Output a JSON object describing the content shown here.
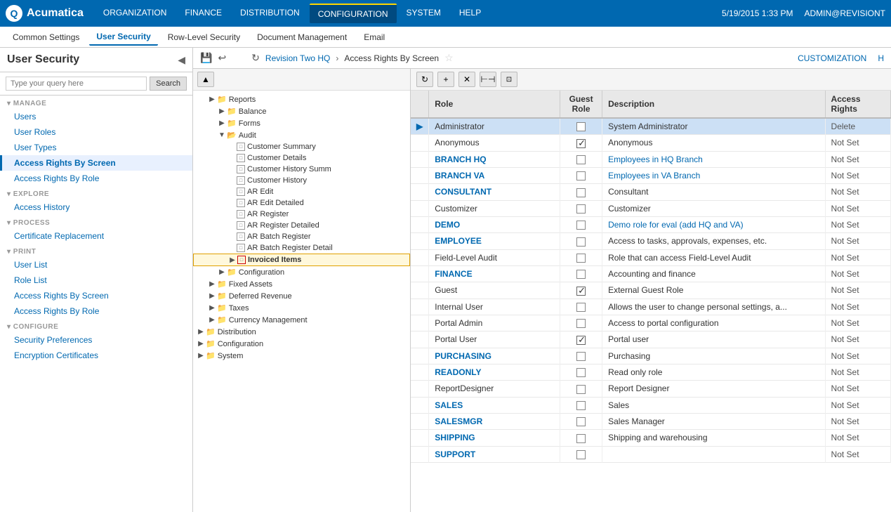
{
  "topNav": {
    "logoText": "Acumatica",
    "navItems": [
      {
        "label": "ORGANIZATION",
        "active": false
      },
      {
        "label": "FINANCE",
        "active": false
      },
      {
        "label": "DISTRIBUTION",
        "active": false
      },
      {
        "label": "CONFIGURATION",
        "active": true
      },
      {
        "label": "SYSTEM",
        "active": false
      },
      {
        "label": "HELP",
        "active": false
      }
    ],
    "datetime": "5/19/2015  1:33 PM",
    "user": "ADMIN@REVISIONT"
  },
  "subNav": {
    "items": [
      {
        "label": "Common Settings",
        "active": false
      },
      {
        "label": "User Security",
        "active": true
      },
      {
        "label": "Row-Level Security",
        "active": false
      },
      {
        "label": "Document Management",
        "active": false
      },
      {
        "label": "Email",
        "active": false
      }
    ]
  },
  "sidebar": {
    "title": "User Security",
    "searchPlaceholder": "Type your query here",
    "searchButton": "Search",
    "sections": [
      {
        "label": "MANAGE",
        "items": [
          {
            "label": "Users",
            "active": false
          },
          {
            "label": "User Roles",
            "active": false
          },
          {
            "label": "User Types",
            "active": false
          },
          {
            "label": "Access Rights By Screen",
            "active": true
          },
          {
            "label": "Access Rights By Role",
            "active": false
          }
        ]
      },
      {
        "label": "EXPLORE",
        "items": [
          {
            "label": "Access History",
            "active": false
          }
        ]
      },
      {
        "label": "PROCESS",
        "items": [
          {
            "label": "Certificate Replacement",
            "active": false
          }
        ]
      },
      {
        "label": "PRINT",
        "items": [
          {
            "label": "User List",
            "active": false
          },
          {
            "label": "Role List",
            "active": false
          },
          {
            "label": "Access Rights By Screen",
            "active": false
          },
          {
            "label": "Access Rights By Role",
            "active": false
          }
        ]
      },
      {
        "label": "CONFIGURE",
        "items": [
          {
            "label": "Security Preferences",
            "active": false
          },
          {
            "label": "Encryption Certificates",
            "active": false
          }
        ]
      }
    ]
  },
  "breadcrumb": {
    "refreshTitle": "Refresh",
    "company": "Revision Two HQ",
    "separator": "›",
    "page": "Access Rights By Screen",
    "customization": "CUSTOMIZATION"
  },
  "treeItems": [
    {
      "label": "Reports",
      "type": "folder",
      "indent": 1,
      "expanded": true,
      "expand": "▶"
    },
    {
      "label": "Balance",
      "type": "folder",
      "indent": 2,
      "expanded": false,
      "expand": "▶"
    },
    {
      "label": "Forms",
      "type": "folder",
      "indent": 2,
      "expanded": false,
      "expand": "▶"
    },
    {
      "label": "Audit",
      "type": "folder",
      "indent": 2,
      "expanded": true,
      "expand": "▼"
    },
    {
      "label": "Customer Summary",
      "type": "page",
      "indent": 3
    },
    {
      "label": "Customer Details",
      "type": "page",
      "indent": 3
    },
    {
      "label": "Customer History Summ",
      "type": "page",
      "indent": 3
    },
    {
      "label": "Customer History",
      "type": "page",
      "indent": 3
    },
    {
      "label": "AR Edit",
      "type": "page",
      "indent": 3
    },
    {
      "label": "AR Edit Detailed",
      "type": "page",
      "indent": 3
    },
    {
      "label": "AR Register",
      "type": "page",
      "indent": 3
    },
    {
      "label": "AR Register Detailed",
      "type": "page",
      "indent": 3
    },
    {
      "label": "AR Batch Register",
      "type": "page",
      "indent": 3
    },
    {
      "label": "AR Batch Register Detail",
      "type": "page",
      "indent": 3
    },
    {
      "label": "Invoiced Items",
      "type": "page",
      "indent": 3,
      "selected": true,
      "hasArrow": true
    },
    {
      "label": "Configuration",
      "type": "folder",
      "indent": 2,
      "expanded": false,
      "expand": "▶"
    },
    {
      "label": "Fixed Assets",
      "type": "folder",
      "indent": 1,
      "expanded": false,
      "expand": "▶"
    },
    {
      "label": "Deferred Revenue",
      "type": "folder",
      "indent": 1,
      "expanded": false,
      "expand": "▶"
    },
    {
      "label": "Taxes",
      "type": "folder",
      "indent": 1,
      "expanded": false,
      "expand": "▶"
    },
    {
      "label": "Currency Management",
      "type": "folder",
      "indent": 1,
      "expanded": false,
      "expand": "▶"
    },
    {
      "label": "Distribution",
      "type": "folder",
      "indent": 0,
      "expanded": false,
      "expand": "▶"
    },
    {
      "label": "Configuration",
      "type": "folder",
      "indent": 0,
      "expanded": false,
      "expand": "▶"
    },
    {
      "label": "System",
      "type": "folder",
      "indent": 0,
      "expanded": false,
      "expand": "▶"
    }
  ],
  "tableColumns": [
    "Role",
    "Guest Role",
    "Description",
    "Access Rights"
  ],
  "tableRows": [
    {
      "role": "Administrator",
      "isRoleBlue": false,
      "guestRole": false,
      "description": "System Administrator",
      "isDescBlue": false,
      "accessRights": "Delete",
      "selected": true
    },
    {
      "role": "Anonymous",
      "isRoleBlue": false,
      "guestRole": true,
      "description": "Anonymous",
      "isDescBlue": false,
      "accessRights": "Not Set"
    },
    {
      "role": "BRANCH HQ",
      "isRoleBlue": true,
      "guestRole": false,
      "description": "Employees in HQ Branch",
      "isDescBlue": true,
      "accessRights": "Not Set"
    },
    {
      "role": "BRANCH VA",
      "isRoleBlue": true,
      "guestRole": false,
      "description": "Employees in VA Branch",
      "isDescBlue": true,
      "accessRights": "Not Set"
    },
    {
      "role": "CONSULTANT",
      "isRoleBlue": true,
      "guestRole": false,
      "description": "Consultant",
      "isDescBlue": false,
      "accessRights": "Not Set"
    },
    {
      "role": "Customizer",
      "isRoleBlue": false,
      "guestRole": false,
      "description": "Customizer",
      "isDescBlue": false,
      "accessRights": "Not Set"
    },
    {
      "role": "DEMO",
      "isRoleBlue": true,
      "guestRole": false,
      "description": "Demo role for eval (add HQ and VA)",
      "isDescBlue": true,
      "accessRights": "Not Set"
    },
    {
      "role": "EMPLOYEE",
      "isRoleBlue": true,
      "guestRole": false,
      "description": "Access to tasks, approvals, expenses, etc.",
      "isDescBlue": false,
      "accessRights": "Not Set"
    },
    {
      "role": "Field-Level Audit",
      "isRoleBlue": false,
      "guestRole": false,
      "description": "Role that can access Field-Level Audit",
      "isDescBlue": false,
      "accessRights": "Not Set"
    },
    {
      "role": "FINANCE",
      "isRoleBlue": true,
      "guestRole": false,
      "description": "Accounting and finance",
      "isDescBlue": false,
      "accessRights": "Not Set"
    },
    {
      "role": "Guest",
      "isRoleBlue": false,
      "guestRole": true,
      "description": "External Guest Role",
      "isDescBlue": false,
      "accessRights": "Not Set"
    },
    {
      "role": "Internal User",
      "isRoleBlue": false,
      "guestRole": false,
      "description": "Allows the user to change personal settings, a...",
      "isDescBlue": false,
      "accessRights": "Not Set"
    },
    {
      "role": "Portal Admin",
      "isRoleBlue": false,
      "guestRole": false,
      "description": "Access to portal configuration",
      "isDescBlue": false,
      "accessRights": "Not Set"
    },
    {
      "role": "Portal User",
      "isRoleBlue": false,
      "guestRole": true,
      "description": "Portal user",
      "isDescBlue": false,
      "accessRights": "Not Set"
    },
    {
      "role": "PURCHASING",
      "isRoleBlue": true,
      "guestRole": false,
      "description": "Purchasing",
      "isDescBlue": false,
      "accessRights": "Not Set"
    },
    {
      "role": "READONLY",
      "isRoleBlue": true,
      "guestRole": false,
      "description": "Read only role",
      "isDescBlue": false,
      "accessRights": "Not Set"
    },
    {
      "role": "ReportDesigner",
      "isRoleBlue": false,
      "guestRole": false,
      "description": "Report Designer",
      "isDescBlue": false,
      "accessRights": "Not Set"
    },
    {
      "role": "SALES",
      "isRoleBlue": true,
      "guestRole": false,
      "description": "Sales",
      "isDescBlue": false,
      "accessRights": "Not Set"
    },
    {
      "role": "SALESMGR",
      "isRoleBlue": true,
      "guestRole": false,
      "description": "Sales Manager",
      "isDescBlue": false,
      "accessRights": "Not Set"
    },
    {
      "role": "SHIPPING",
      "isRoleBlue": true,
      "guestRole": false,
      "description": "Shipping and warehousing",
      "isDescBlue": false,
      "accessRights": "Not Set"
    },
    {
      "role": "SUPPORT",
      "isRoleBlue": true,
      "guestRole": false,
      "description": "",
      "isDescBlue": false,
      "accessRights": "Not Set"
    }
  ],
  "rightToolbar": {
    "buttons": [
      "↻",
      "+",
      "✕",
      "⊢⊣",
      "⊡"
    ]
  }
}
